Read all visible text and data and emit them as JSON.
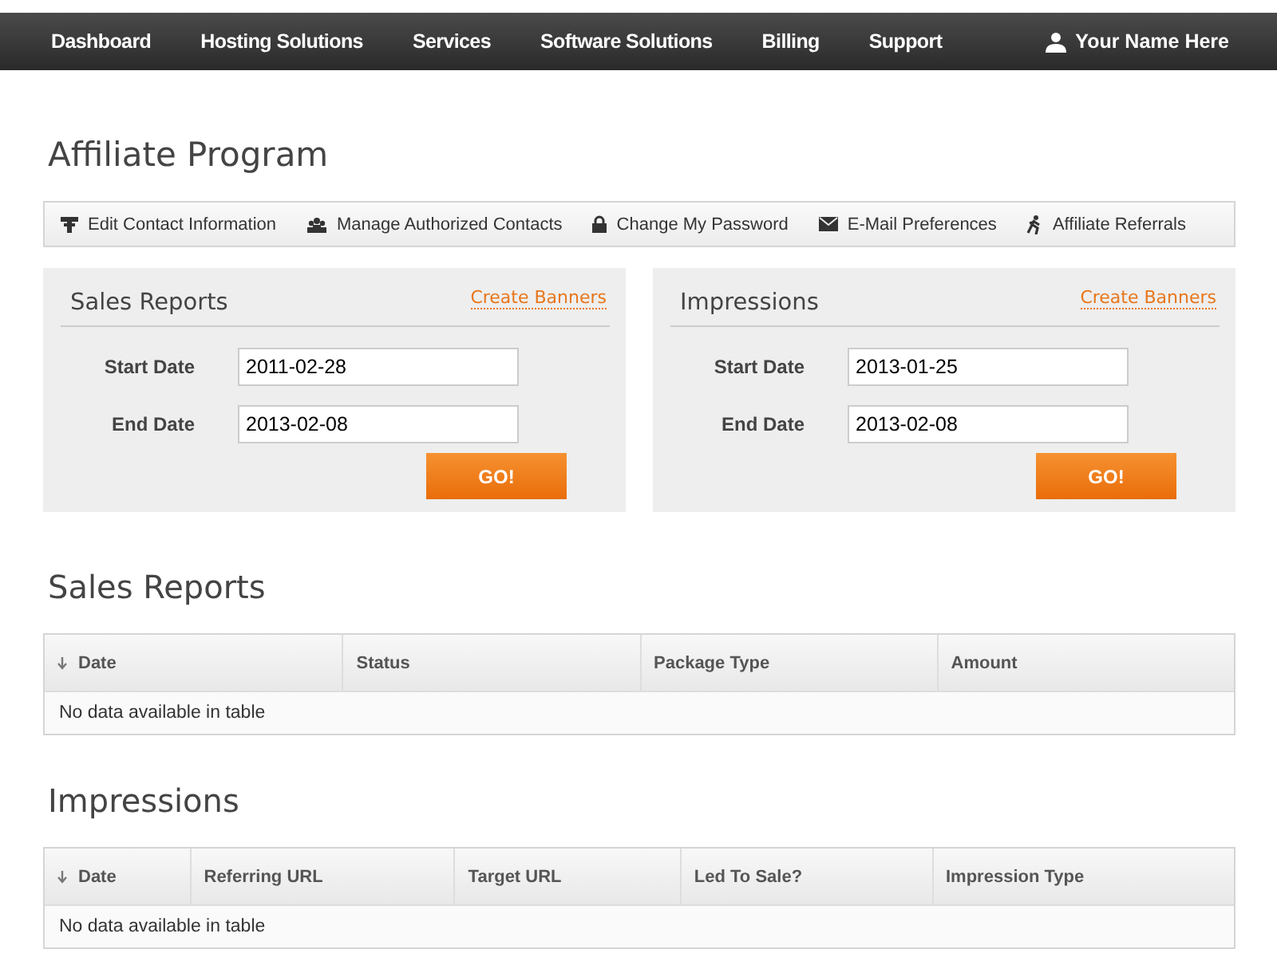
{
  "nav": {
    "items": [
      "Dashboard",
      "Hosting Solutions",
      "Services",
      "Software Solutions",
      "Billing",
      "Support"
    ],
    "user": "Your Name Here"
  },
  "page_title": "Affiliate Program",
  "subnav": [
    {
      "kind": "contact",
      "label": "Edit Contact Information"
    },
    {
      "kind": "people",
      "label": "Manage Authorized Contacts"
    },
    {
      "kind": "lock",
      "label": "Change My Password"
    },
    {
      "kind": "mail",
      "label": "E-Mail Preferences"
    },
    {
      "kind": "runner",
      "label": "Affiliate Referrals"
    }
  ],
  "forms": [
    {
      "title": "Sales Reports",
      "link": "Create Banners",
      "fields": [
        {
          "label": "Start Date",
          "value": "2011-02-28"
        },
        {
          "label": "End Date",
          "value": "2013-02-08"
        }
      ],
      "button": "GO!"
    },
    {
      "title": "Impressions",
      "link": "Create Banners",
      "fields": [
        {
          "label": "Start Date",
          "value": "2013-01-25"
        },
        {
          "label": "End Date",
          "value": "2013-02-08"
        }
      ],
      "button": "GO!"
    }
  ],
  "tables": [
    {
      "title": "Sales Reports",
      "columns": [
        "Date",
        "Status",
        "Package Type",
        "Amount"
      ],
      "empty": "No data available in table"
    },
    {
      "title": "Impressions",
      "columns": [
        "Date",
        "Referring URL",
        "Target URL",
        "Led To Sale?",
        "Impression Type"
      ],
      "empty": "No data available in table"
    }
  ]
}
